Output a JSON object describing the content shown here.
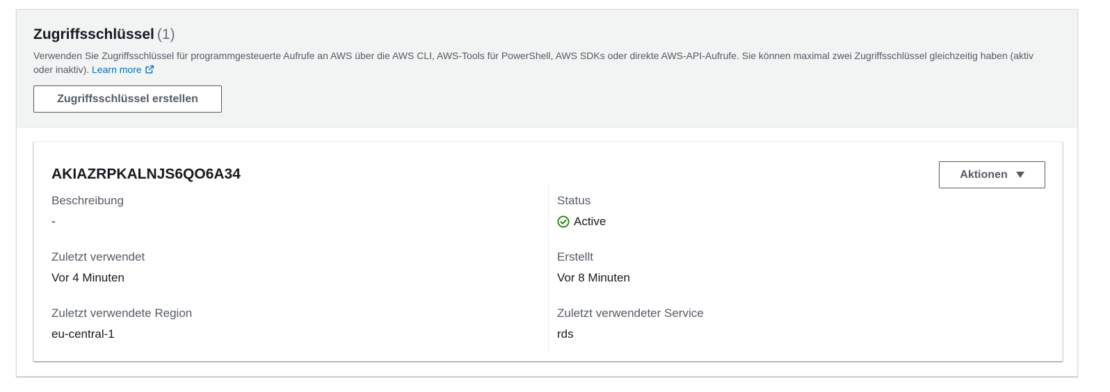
{
  "section": {
    "title": "Zugriffsschlüssel",
    "count": "(1)",
    "description": "Verwenden Sie Zugriffsschlüssel für programmgesteuerte Aufrufe an AWS über die AWS CLI, AWS-Tools für PowerShell, AWS SDKs oder direkte AWS-API-Aufrufe. Sie können maximal zwei Zugriffsschlüssel gleichzeitig haben (aktiv oder inaktiv).",
    "learn_more": "Learn more",
    "create_button": "Zugriffsschlüssel erstellen"
  },
  "key": {
    "id": "AKIAZRPKALNJS6QO6A34",
    "actions_button": "Aktionen",
    "fields": {
      "description_label": "Beschreibung",
      "description_value": "-",
      "status_label": "Status",
      "status_value": "Active",
      "last_used_label": "Zuletzt verwendet",
      "last_used_value": "Vor 4 Minuten",
      "created_label": "Erstellt",
      "created_value": "Vor 8 Minuten",
      "last_region_label": "Zuletzt verwendete Region",
      "last_region_value": "eu-central-1",
      "last_service_label": "Zuletzt verwendeter Service",
      "last_service_value": "rds"
    }
  },
  "colors": {
    "link": "#0073bb",
    "status_active": "#1d8102",
    "header_bg": "#f2f3f3"
  },
  "icons": {
    "external_link": "external-link-icon",
    "status": "check-circle-icon",
    "dropdown": "caret-down-icon"
  }
}
